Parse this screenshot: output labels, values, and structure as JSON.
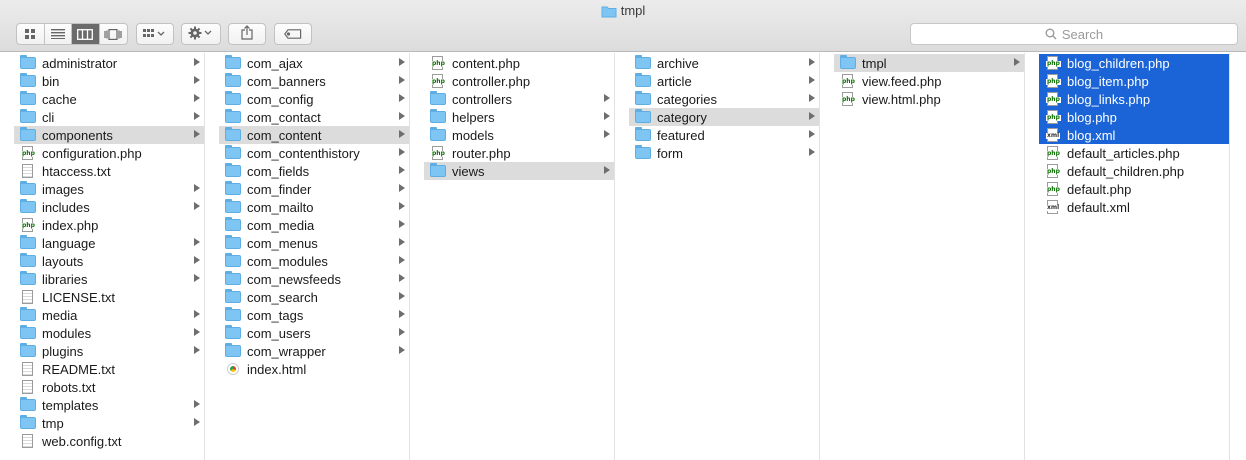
{
  "window": {
    "title": "tmpl"
  },
  "toolbar": {
    "view_icons": [
      "icon-view-icon",
      "list-view-icon",
      "column-view-icon",
      "cover-flow-icon"
    ],
    "group_icon": "arrange-icon",
    "action_icon": "gear-icon",
    "share_icon": "share-icon",
    "tag_icon": "tag-icon"
  },
  "search": {
    "placeholder": "Search"
  },
  "columns": [
    {
      "items": [
        {
          "name": "administrator",
          "type": "folder",
          "arrow": true
        },
        {
          "name": "bin",
          "type": "folder",
          "arrow": true
        },
        {
          "name": "cache",
          "type": "folder",
          "arrow": true
        },
        {
          "name": "cli",
          "type": "folder",
          "arrow": true
        },
        {
          "name": "components",
          "type": "folder",
          "arrow": true,
          "selected": "gray"
        },
        {
          "name": "configuration.php",
          "type": "php"
        },
        {
          "name": "htaccess.txt",
          "type": "txt"
        },
        {
          "name": "images",
          "type": "folder",
          "arrow": true
        },
        {
          "name": "includes",
          "type": "folder",
          "arrow": true
        },
        {
          "name": "index.php",
          "type": "php"
        },
        {
          "name": "language",
          "type": "folder",
          "arrow": true
        },
        {
          "name": "layouts",
          "type": "folder",
          "arrow": true
        },
        {
          "name": "libraries",
          "type": "folder",
          "arrow": true
        },
        {
          "name": "LICENSE.txt",
          "type": "txt"
        },
        {
          "name": "media",
          "type": "folder",
          "arrow": true
        },
        {
          "name": "modules",
          "type": "folder",
          "arrow": true
        },
        {
          "name": "plugins",
          "type": "folder",
          "arrow": true
        },
        {
          "name": "README.txt",
          "type": "txt"
        },
        {
          "name": "robots.txt",
          "type": "txt"
        },
        {
          "name": "templates",
          "type": "folder",
          "arrow": true
        },
        {
          "name": "tmp",
          "type": "folder",
          "arrow": true
        },
        {
          "name": "web.config.txt",
          "type": "txt"
        }
      ]
    },
    {
      "items": [
        {
          "name": "com_ajax",
          "type": "folder",
          "arrow": true
        },
        {
          "name": "com_banners",
          "type": "folder",
          "arrow": true
        },
        {
          "name": "com_config",
          "type": "folder",
          "arrow": true
        },
        {
          "name": "com_contact",
          "type": "folder",
          "arrow": true
        },
        {
          "name": "com_content",
          "type": "folder",
          "arrow": true,
          "selected": "gray"
        },
        {
          "name": "com_contenthistory",
          "type": "folder",
          "arrow": true
        },
        {
          "name": "com_fields",
          "type": "folder",
          "arrow": true
        },
        {
          "name": "com_finder",
          "type": "folder",
          "arrow": true
        },
        {
          "name": "com_mailto",
          "type": "folder",
          "arrow": true
        },
        {
          "name": "com_media",
          "type": "folder",
          "arrow": true
        },
        {
          "name": "com_menus",
          "type": "folder",
          "arrow": true
        },
        {
          "name": "com_modules",
          "type": "folder",
          "arrow": true
        },
        {
          "name": "com_newsfeeds",
          "type": "folder",
          "arrow": true
        },
        {
          "name": "com_search",
          "type": "folder",
          "arrow": true
        },
        {
          "name": "com_tags",
          "type": "folder",
          "arrow": true
        },
        {
          "name": "com_users",
          "type": "folder",
          "arrow": true
        },
        {
          "name": "com_wrapper",
          "type": "folder",
          "arrow": true
        },
        {
          "name": "index.html",
          "type": "html"
        }
      ]
    },
    {
      "items": [
        {
          "name": "content.php",
          "type": "php"
        },
        {
          "name": "controller.php",
          "type": "php"
        },
        {
          "name": "controllers",
          "type": "folder",
          "arrow": true
        },
        {
          "name": "helpers",
          "type": "folder",
          "arrow": true
        },
        {
          "name": "models",
          "type": "folder",
          "arrow": true
        },
        {
          "name": "router.php",
          "type": "php"
        },
        {
          "name": "views",
          "type": "folder",
          "arrow": true,
          "selected": "gray"
        }
      ]
    },
    {
      "items": [
        {
          "name": "archive",
          "type": "folder",
          "arrow": true
        },
        {
          "name": "article",
          "type": "folder",
          "arrow": true
        },
        {
          "name": "categories",
          "type": "folder",
          "arrow": true
        },
        {
          "name": "category",
          "type": "folder",
          "arrow": true,
          "selected": "gray"
        },
        {
          "name": "featured",
          "type": "folder",
          "arrow": true
        },
        {
          "name": "form",
          "type": "folder",
          "arrow": true
        }
      ]
    },
    {
      "items": [
        {
          "name": "tmpl",
          "type": "folder",
          "arrow": true,
          "selected": "gray"
        },
        {
          "name": "view.feed.php",
          "type": "php"
        },
        {
          "name": "view.html.php",
          "type": "php"
        }
      ]
    },
    {
      "items": [
        {
          "name": "blog_children.php",
          "type": "php",
          "selected": "blue"
        },
        {
          "name": "blog_item.php",
          "type": "php",
          "selected": "blue"
        },
        {
          "name": "blog_links.php",
          "type": "php",
          "selected": "blue"
        },
        {
          "name": "blog.php",
          "type": "php",
          "selected": "blue"
        },
        {
          "name": "blog.xml",
          "type": "xml",
          "selected": "blue"
        },
        {
          "name": "default_articles.php",
          "type": "php"
        },
        {
          "name": "default_children.php",
          "type": "php"
        },
        {
          "name": "default.php",
          "type": "php"
        },
        {
          "name": "default.xml",
          "type": "xml"
        }
      ]
    }
  ]
}
